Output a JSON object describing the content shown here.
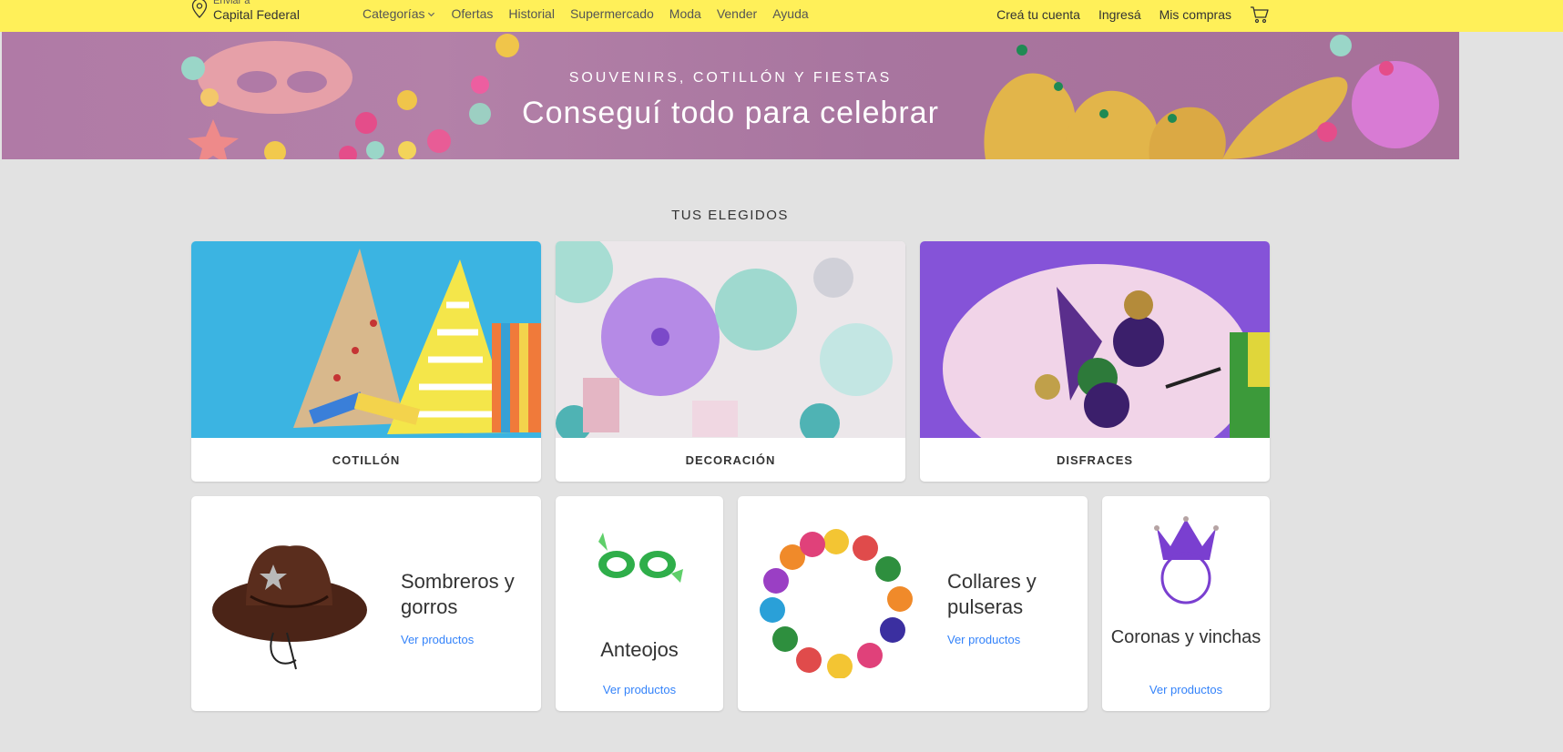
{
  "header": {
    "location_small": "Enviar a",
    "location_main": "Capital Federal",
    "nav": [
      {
        "label": "Categorías"
      },
      {
        "label": "Ofertas"
      },
      {
        "label": "Historial"
      },
      {
        "label": "Supermercado"
      },
      {
        "label": "Moda"
      },
      {
        "label": "Vender"
      },
      {
        "label": "Ayuda"
      }
    ],
    "account_links": [
      {
        "label": "Creá tu cuenta"
      },
      {
        "label": "Ingresá"
      },
      {
        "label": "Mis compras"
      }
    ],
    "icons": [
      "location-pin-icon",
      "chevron-down-icon",
      "cart-icon"
    ],
    "colors": {
      "header_bg": "#fff059",
      "link": "#3483fa",
      "page_bg": "#e2e2e2"
    }
  },
  "banner": {
    "subtitle": "SOUVENIRS, COTILLÓN Y FIESTAS",
    "title": "Conseguí todo para celebrar"
  },
  "section": {
    "title": "TUS ELEGIDOS"
  },
  "categories": [
    {
      "label": "COTILLÓN"
    },
    {
      "label": "DECORACIÓN"
    },
    {
      "label": "DISFRACES"
    }
  ],
  "products": [
    {
      "title": "Sombreros y gorros",
      "link": "Ver productos"
    },
    {
      "title": "Anteojos",
      "link": "Ver productos"
    },
    {
      "title": "Collares y pulseras",
      "link": "Ver productos"
    },
    {
      "title": "Coronas y vinchas",
      "link": "Ver productos"
    }
  ]
}
